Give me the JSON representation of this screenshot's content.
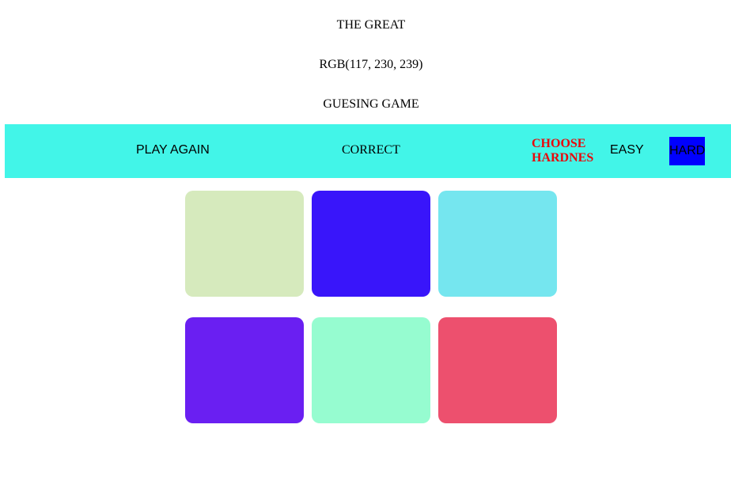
{
  "header": {
    "line1": "THE GREAT",
    "line2": "RGB(117, 230, 239)",
    "line3": "GUESING GAME"
  },
  "bar": {
    "play_again": "PLAY AGAIN",
    "status": "CORRECT",
    "choose_line1": "CHOOSE",
    "choose_line2": "HARDNES",
    "easy": "EASY",
    "hard": "HARD",
    "background": "#42f5e8",
    "hard_background": "#0000ff",
    "choose_color": "#e8080c"
  },
  "squares": [
    {
      "color": "#d6eabd"
    },
    {
      "color": "#3915fa"
    },
    {
      "color": "#75e6ef"
    },
    {
      "color": "#6a1ff2"
    },
    {
      "color": "#96fcd0"
    },
    {
      "color": "#ed506e"
    }
  ]
}
